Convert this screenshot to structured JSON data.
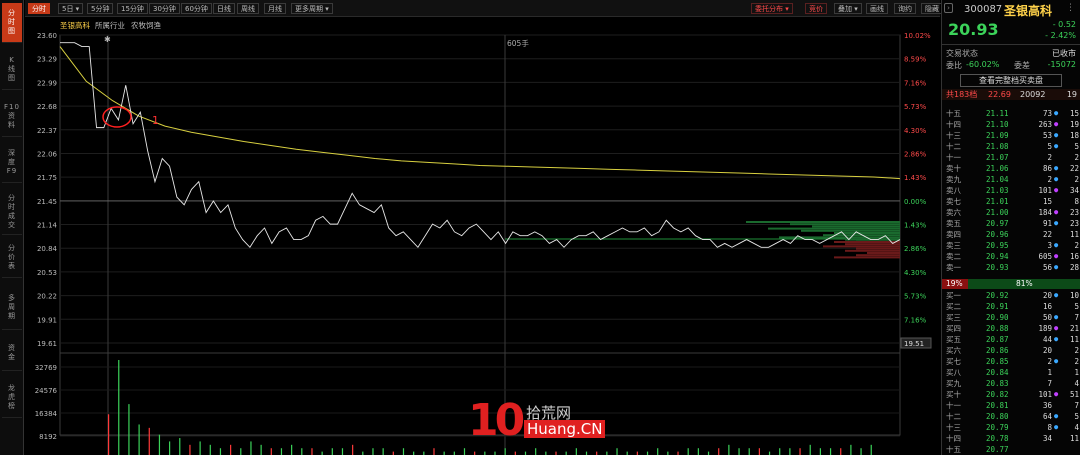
{
  "sidebar": [
    {
      "label": "分\n时\n图",
      "active": true
    },
    {
      "label": "K\n线\n图",
      "active": false
    },
    {
      "label": "F10\n资\n料",
      "active": false
    },
    {
      "label": "深\n度\nF9",
      "active": false
    },
    {
      "label": "分\n时\n成\n交",
      "active": false
    },
    {
      "label": "分\n价\n表",
      "active": false
    },
    {
      "label": "多\n周\n期",
      "active": false
    },
    {
      "label": "资\n金",
      "active": false
    },
    {
      "label": "龙\n虎\n榜",
      "active": false
    }
  ],
  "toolbar": {
    "tabs": [
      "分时",
      "5日 ▾",
      "5分钟",
      "15分钟",
      "30分钟",
      "60分钟",
      "日线",
      "周线",
      "月线",
      "更多周期 ▾"
    ],
    "right": [
      "委托分布 ▾",
      "竞价",
      "叠加 ▾",
      "画线",
      "询约",
      "隐藏 ▾"
    ]
  },
  "chart": {
    "legend": [
      "圣银高科",
      "所属行业",
      "农牧饲渔"
    ],
    "price_ticks": [
      "23.60",
      "23.29",
      "22.99",
      "22.68",
      "22.37",
      "22.06",
      "21.75",
      "21.45",
      "21.14",
      "20.84",
      "20.53",
      "20.22",
      "19.91",
      "19.61"
    ],
    "pct_ticks": [
      "10.02%",
      "8.59%",
      "7.16%",
      "5.73%",
      "4.30%",
      "2.86%",
      "1.43%",
      "0.00%",
      "1.43%",
      "2.86%",
      "4.30%",
      "5.73%",
      "7.16%"
    ],
    "vol_ticks": [
      "32769",
      "24576",
      "16384",
      "8192"
    ],
    "vol_max_label": "605手",
    "price_cursor": "19.51",
    "annotation": "1",
    "prev_close": 21.45,
    "price_line": [
      23.5,
      23.5,
      23.5,
      23.45,
      23.45,
      22.4,
      22.4,
      22.65,
      22.5,
      22.95,
      22.45,
      22.6,
      22.1,
      21.7,
      22.0,
      21.9,
      21.5,
      21.4,
      21.6,
      21.7,
      21.3,
      21.45,
      21.3,
      21.4,
      21.1,
      20.95,
      20.85,
      21.0,
      21.1,
      20.9,
      21.05,
      21.1,
      20.95,
      20.95,
      21.0,
      21.2,
      21.25,
      21.15,
      21.15,
      21.35,
      21.55,
      21.4,
      21.35,
      21.3,
      21.4,
      21.1,
      21.0,
      21.05,
      20.95,
      20.85,
      21.0,
      21.15,
      21.1,
      21.2,
      21.05,
      21.0,
      21.1,
      21.15,
      21.05,
      20.95,
      21.05,
      20.9,
      21.05,
      21.0,
      21.0,
      21.05,
      21.0,
      20.9,
      20.95,
      20.85,
      20.95,
      21.0,
      21.0,
      21.05,
      20.95,
      21.0,
      21.05,
      21.1,
      21.05,
      21.05,
      21.1,
      21.0,
      21.05,
      21.2,
      21.1,
      21.05,
      21.1,
      21.0,
      20.95,
      20.95,
      20.85,
      20.9,
      20.85,
      20.9,
      20.95,
      20.9,
      20.85,
      20.85,
      20.9,
      20.95,
      20.9,
      21.0,
      20.95,
      20.95,
      20.9,
      20.95,
      21.0,
      21.05,
      20.95,
      21.05,
      21.0,
      20.95,
      20.95,
      21.0,
      20.9,
      20.95
    ],
    "avg_line": [
      23.45,
      23.0,
      22.75,
      22.55,
      22.42,
      22.34,
      22.28,
      22.22,
      22.17,
      22.12,
      22.08,
      22.04,
      22.0,
      21.97,
      21.95,
      21.93,
      21.91,
      21.9,
      21.89,
      21.88,
      21.87,
      21.86,
      21.85,
      21.84,
      21.83,
      21.82,
      21.81,
      21.8,
      21.79,
      21.78,
      21.77,
      21.76,
      21.74
    ],
    "volume": [
      12,
      28,
      15,
      9,
      8,
      6,
      4,
      5,
      3,
      4,
      3,
      2,
      3,
      2,
      4,
      3,
      2,
      2,
      3,
      2,
      2,
      1,
      2,
      2,
      3,
      1,
      2,
      2,
      1,
      2,
      1,
      1,
      2,
      1,
      1,
      2,
      1,
      1,
      1,
      2,
      1,
      1,
      2,
      1,
      1,
      1,
      2,
      1,
      1,
      1,
      2,
      1,
      1,
      1,
      2,
      1,
      1,
      2,
      2,
      1,
      2,
      3,
      2,
      2,
      2,
      1,
      2,
      2,
      2,
      3,
      2,
      2,
      2,
      3,
      2,
      3
    ]
  },
  "quote": {
    "code": "300087",
    "name": "圣银高科",
    "price": "20.93",
    "change": "- 0.52",
    "pct": "- 2.42%",
    "status_label": "交易状态",
    "status_value": "已收市",
    "ratio_label": "委比",
    "ratio_value": "-60.02%",
    "diff_label": "委差",
    "diff_value": "-15072",
    "view_btn": "查看完整档买卖盘",
    "summary_label": "共183档",
    "summary_price": "22.69",
    "summary_vol": "20092",
    "summary_cnt": "19",
    "split_left": "19%",
    "split_right": "81%"
  },
  "asks": [
    [
      "十五",
      "21.11",
      "73",
      "15"
    ],
    [
      "十四",
      "21.10",
      "263",
      "19"
    ],
    [
      "十三",
      "21.09",
      "53",
      "18"
    ],
    [
      "十二",
      "21.08",
      "5",
      "5"
    ],
    [
      "十一",
      "21.07",
      "2",
      "2"
    ],
    [
      "卖十",
      "21.06",
      "86",
      "22"
    ],
    [
      "卖九",
      "21.04",
      "2",
      "2"
    ],
    [
      "卖八",
      "21.03",
      "101",
      "34"
    ],
    [
      "卖七",
      "21.01",
      "15",
      "8"
    ],
    [
      "卖六",
      "21.00",
      "184",
      "23"
    ],
    [
      "卖五",
      "20.97",
      "91",
      "23"
    ],
    [
      "卖四",
      "20.96",
      "22",
      "11"
    ],
    [
      "卖三",
      "20.95",
      "3",
      "2"
    ],
    [
      "卖二",
      "20.94",
      "605",
      "16"
    ],
    [
      "卖一",
      "20.93",
      "56",
      "28"
    ]
  ],
  "bids": [
    [
      "买一",
      "20.92",
      "20",
      "10"
    ],
    [
      "买二",
      "20.91",
      "16",
      "5"
    ],
    [
      "买三",
      "20.90",
      "50",
      "7"
    ],
    [
      "买四",
      "20.88",
      "189",
      "21"
    ],
    [
      "买五",
      "20.87",
      "44",
      "11"
    ],
    [
      "买六",
      "20.86",
      "20",
      "2"
    ],
    [
      "买七",
      "20.85",
      "2",
      "2"
    ],
    [
      "买八",
      "20.84",
      "1",
      "1"
    ],
    [
      "买九",
      "20.83",
      "7",
      "4"
    ],
    [
      "买十",
      "20.82",
      "101",
      "51"
    ],
    [
      "十一",
      "20.81",
      "36",
      "7"
    ],
    [
      "十二",
      "20.80",
      "64",
      "5"
    ],
    [
      "十三",
      "20.79",
      "8",
      "4"
    ],
    [
      "十四",
      "20.78",
      "34",
      "11"
    ],
    [
      "十五",
      "20.77",
      "",
      ""
    ]
  ],
  "watermark": {
    "top": "拾荒网",
    "bottom": "Huang.CN",
    "digits": "10"
  }
}
